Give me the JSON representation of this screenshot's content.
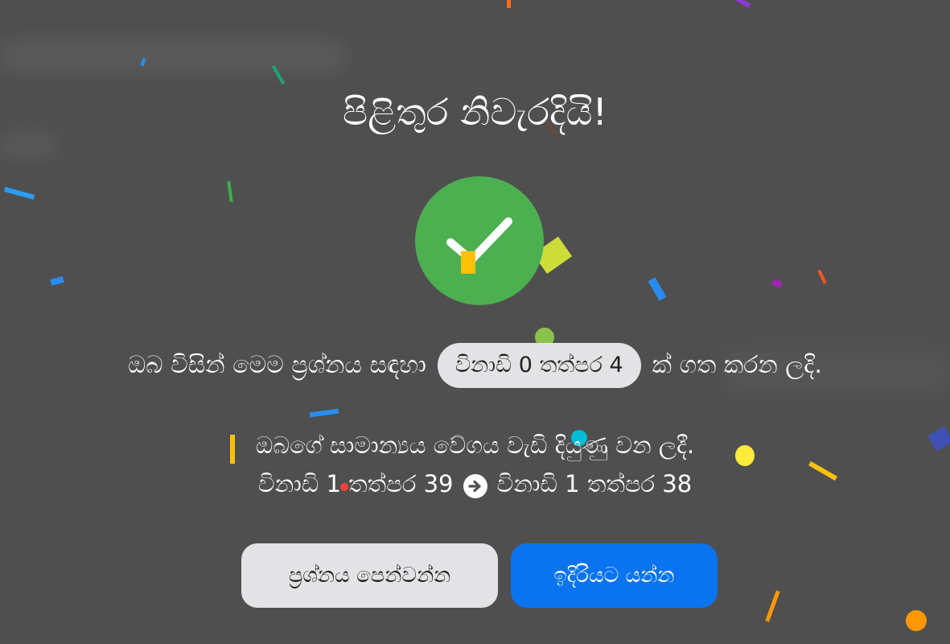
{
  "modal": {
    "title": "පිළිතුර නිවැරදියි!",
    "time_prefix": "ඔබ විසින් මෙම ප්‍රශ්නය සඳහා",
    "time_value": "විනාඩි 0 තත්පර 4",
    "time_suffix": "ක් ගත කරන ලදි.",
    "speed_message": "ඔබගේ සාමාන්‍යය වේගය වැඩි දියුණු වන ලදී.",
    "previous_average": "විනාඩි 1 තත්පර 39",
    "new_average": "විනාඩි 1 තත්පර 38"
  },
  "buttons": {
    "show_question": "ප්‍රශ්නය පෙන්වන්න",
    "next": "ඉදිරියට යන්න"
  },
  "colors": {
    "backdrop": "#4f4f4f",
    "success": "#4caf50",
    "primary": "#0a74f0",
    "secondary": "#e3e3e6"
  },
  "icons": {
    "success": "check-circle-icon",
    "transition": "arrow-right-circle-icon"
  }
}
